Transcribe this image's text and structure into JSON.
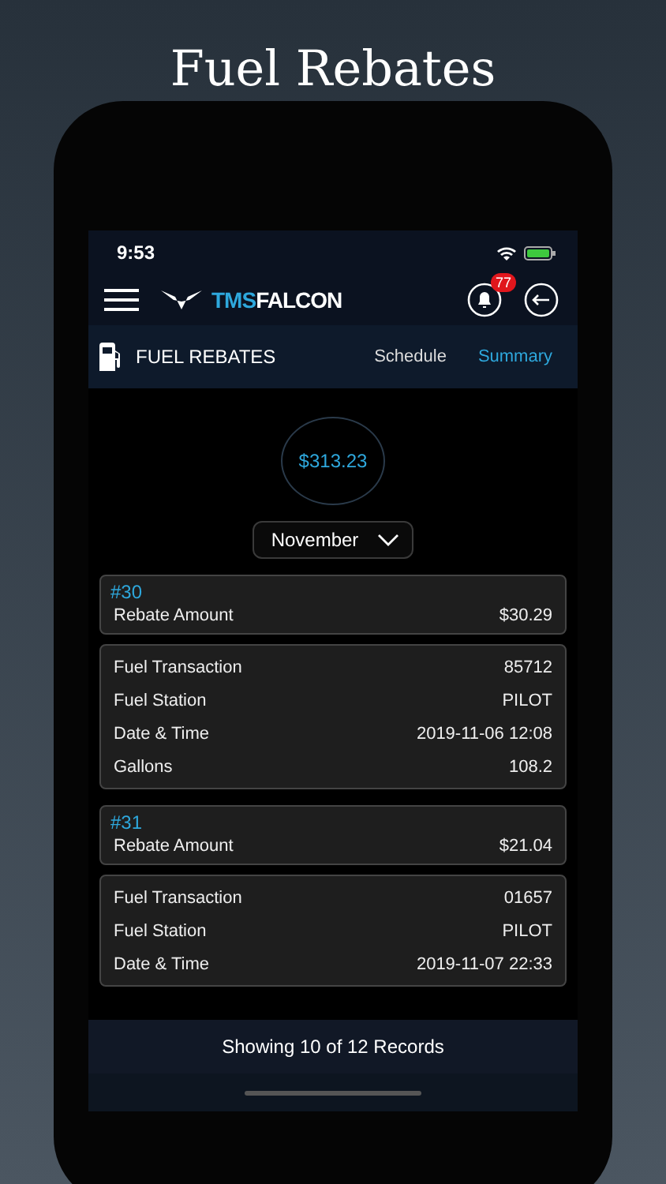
{
  "headline": "Fuel Rebates",
  "status_bar": {
    "time": "9:53"
  },
  "header": {
    "brand_part_1": "TMS",
    "brand_part_2": "FALCON",
    "notification_count": "77"
  },
  "subheader": {
    "title": "FUEL REBATES",
    "tabs": [
      {
        "label": "Schedule",
        "selected": false
      },
      {
        "label": "Summary",
        "selected": true
      }
    ]
  },
  "total": "$313.23",
  "month_dropdown": {
    "value": "November"
  },
  "records": [
    {
      "number": "#30",
      "rebate_label": "Rebate Amount",
      "rebate_value": "$30.29",
      "details": [
        {
          "label": "Fuel Transaction",
          "value": "85712"
        },
        {
          "label": "Fuel Station",
          "value": "PILOT"
        },
        {
          "label": "Date & Time",
          "value": "2019-11-06 12:08"
        },
        {
          "label": "Gallons",
          "value": "108.2"
        }
      ]
    },
    {
      "number": "#31",
      "rebate_label": "Rebate Amount",
      "rebate_value": "$21.04",
      "details": [
        {
          "label": "Fuel Transaction",
          "value": "01657"
        },
        {
          "label": "Fuel Station",
          "value": "PILOT"
        },
        {
          "label": "Date & Time",
          "value": "2019-11-07 22:33"
        }
      ]
    }
  ],
  "footer": "Showing 10 of 12 Records"
}
